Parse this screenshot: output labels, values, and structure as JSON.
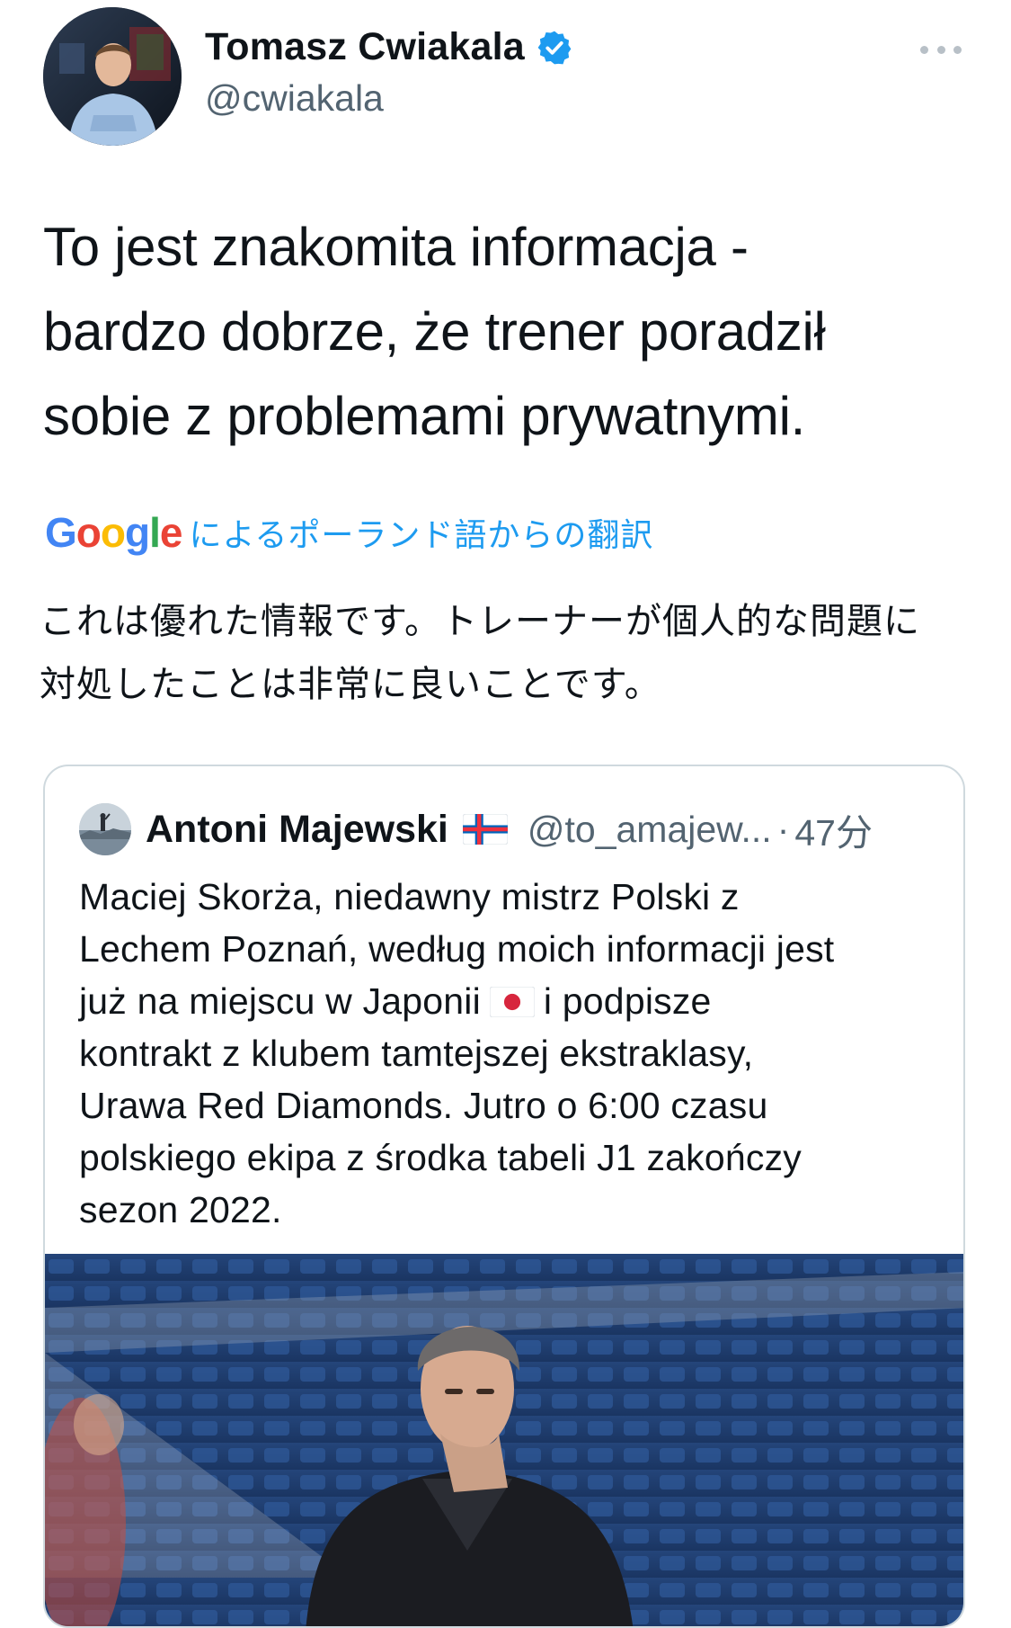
{
  "tweet": {
    "author_name": "Tomasz Cwiakala",
    "author_handle": "@cwiakala",
    "text_lines": [
      "To jest znakomita informacja -",
      "bardzo dobrze, że trener poradził",
      "sobie z problemami prywatnymi."
    ],
    "translation": {
      "google_letters": [
        "G",
        "o",
        "o",
        "g",
        "l",
        "e"
      ],
      "label": "によるポーランド語からの翻訳",
      "text_lines": [
        "これは優れた情報です。トレーナーが個人的な問題に",
        "対処したことは非常に良いことです。"
      ]
    }
  },
  "quote": {
    "author_name": "Antoni Majewski",
    "author_handle": "@to_amajew...",
    "separator": "·",
    "time": "47分",
    "text_lines": [
      "Maciej Skorża, niedawny mistrz Polski z",
      "Lechem Poznań, według moich informacji jest",
      "już na miejscu w Japonii",
      "i podpisze",
      "kontrakt z klubem tamtejszej ekstraklasy,",
      "Urawa Red Diamonds. Jutro o 6:00 czasu",
      "polskiego ekipa z środka tabeli J1 zakończy",
      "sezon 2022."
    ]
  },
  "icons": {
    "verified": "verified-badge-icon",
    "more": "more-options-icon",
    "flag_author": "faroe-islands-flag-icon",
    "flag_inline": "japan-flag-icon"
  },
  "colors": {
    "accent": "#1d9bf0",
    "secondary_text": "#536471",
    "border": "#cfd9de"
  }
}
